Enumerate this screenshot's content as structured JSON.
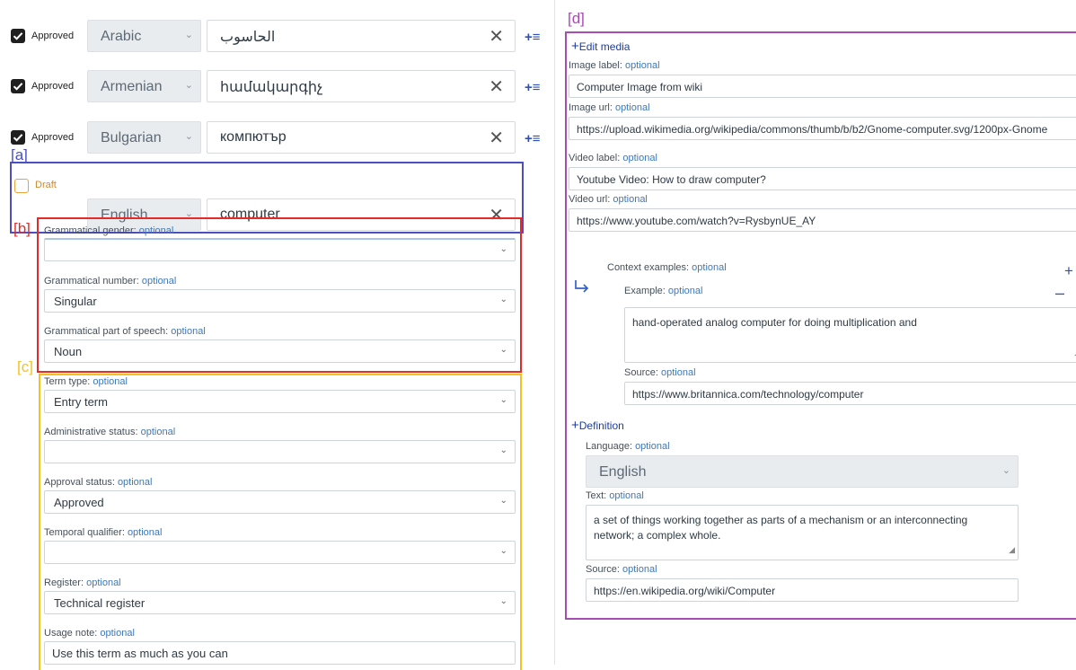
{
  "annotations": {
    "a": "[a]",
    "b": "[b]",
    "c": "[c]",
    "d": "[d]"
  },
  "colors": {
    "a": "#4a4fc4",
    "b": "#e52a2a",
    "c": "#f3c21f",
    "d": "#a74cb3",
    "draft": "#e8a33c",
    "link": "#1f3c9c",
    "optional": "#3f78b7"
  },
  "icons": {
    "add_to_list": "plus-list-icon",
    "clear": "close-icon",
    "checked": "checkbox-checked-icon",
    "chevron": "chevron-down-icon",
    "reply": "return-arrow-icon",
    "resize": "resize-grip-icon"
  },
  "terms": [
    {
      "status": "Approved",
      "language": "Arabic",
      "value": "الحاسوب"
    },
    {
      "status": "Approved",
      "language": "Armenian",
      "value": "համակարգիչ"
    },
    {
      "status": "Approved",
      "language": "Bulgarian",
      "value": "компютър"
    },
    {
      "status": "Draft",
      "language": "English",
      "value": "computer"
    }
  ],
  "grammar": {
    "gender_label": "Grammatical gender:",
    "gender_value": "",
    "number_label": "Grammatical number:",
    "number_value": "Singular",
    "pos_label": "Grammatical part of speech:",
    "pos_value": "Noun"
  },
  "term_details": {
    "type_label": "Term type:",
    "type_value": "Entry term",
    "admin_label": "Administrative status:",
    "admin_value": "",
    "approval_label": "Approval status:",
    "approval_value": "Approved",
    "temporal_label": "Temporal qualifier:",
    "temporal_value": "",
    "register_label": "Register:",
    "register_value": "Technical register",
    "usage_label": "Usage note:",
    "usage_value": "Use this term as much as you can"
  },
  "optional": "optional",
  "plus": "+",
  "minus": "–",
  "media": {
    "edit_link": "Edit media",
    "image_label_label": "Image label:",
    "image_label_value": "Computer Image from wiki",
    "image_url_label": "Image url:",
    "image_url_value": "https://upload.wikimedia.org/wikipedia/commons/thumb/b/b2/Gnome-computer.svg/1200px-Gnome",
    "video_label_label": "Video label:",
    "video_label_value": "Youtube Video: How to draw computer?",
    "video_url_label": "Video url:",
    "video_url_value": "https://www.youtube.com/watch?v=RysbynUE_AY"
  },
  "context": {
    "heading": "Context examples:",
    "example_label": "Example:",
    "example_value": "hand-operated analog computer for doing multiplication and",
    "source_label": "Source:",
    "source_value": "https://www.britannica.com/technology/computer"
  },
  "definition": {
    "link": "Definition",
    "language_label": "Language:",
    "language_value": "English",
    "text_label": "Text:",
    "text_value": "a set of things working together as parts of a mechanism or an interconnecting network; a complex whole.",
    "source_label": "Source:",
    "source_value": "https://en.wikipedia.org/wiki/Computer"
  }
}
